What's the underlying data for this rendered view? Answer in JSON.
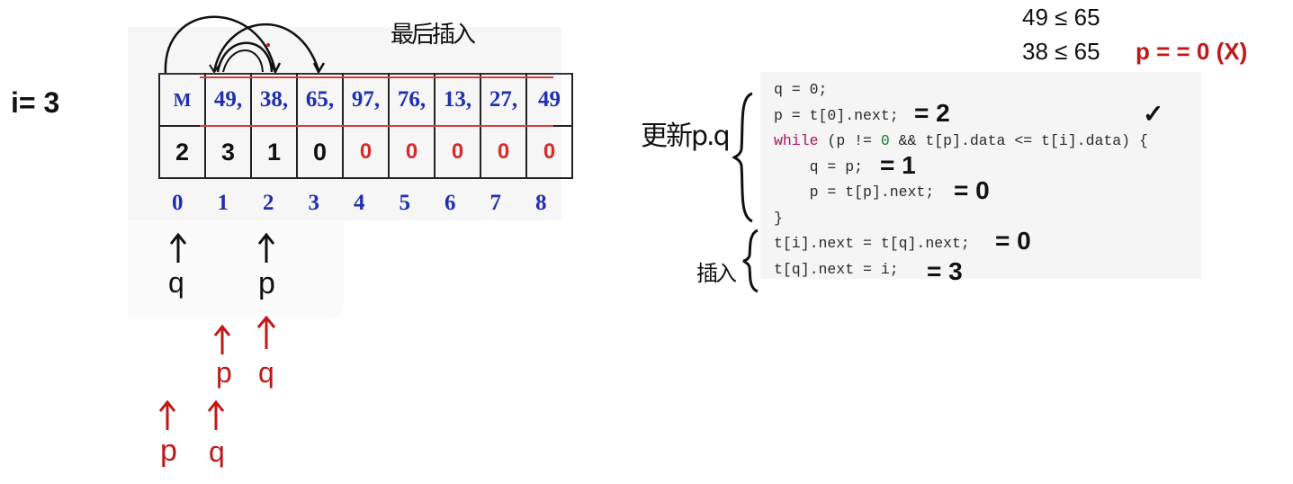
{
  "left": {
    "i_label": "i= 3",
    "note": "最后插入",
    "data_row": [
      "M",
      "49,",
      "38,",
      "65,",
      "97,",
      "76,",
      "13,",
      "27,",
      "49"
    ],
    "next_row": [
      "2",
      "3",
      "1",
      "0",
      "0",
      "0",
      "0",
      "0",
      "0"
    ],
    "indices": [
      "0",
      "1",
      "2",
      "3",
      "4",
      "5",
      "6",
      "7",
      "8"
    ],
    "arrow_q_label": "q",
    "arrow_p_label": "p",
    "red_p1": "p",
    "red_q1": "q",
    "red_p2": "p",
    "red_q2": "q"
  },
  "code": {
    "line1": "q = 0;",
    "line2": "p = t[0].next;",
    "line3a": "while",
    "line3b": " (p != ",
    "line3c": "0",
    "line3d": " && t[p].data <= t[i].data) {",
    "line4": "    q = p;",
    "line5": "    p = t[p].next;",
    "line6": "}",
    "line7": "t[i].next = t[q].next;",
    "line8": "t[q].next = i;"
  },
  "annotations": {
    "eq2": "= 2",
    "eq1": "= 1",
    "eq0_a": "= 0",
    "eq0_b": "= 0",
    "eq3": "= 3",
    "check": "✓",
    "update_pq": "更新p.q",
    "insert": "插入",
    "cmp1": "49 ≤ 65",
    "cmp2": "38 ≤ 65",
    "cond": "p = = 0 (X)"
  }
}
